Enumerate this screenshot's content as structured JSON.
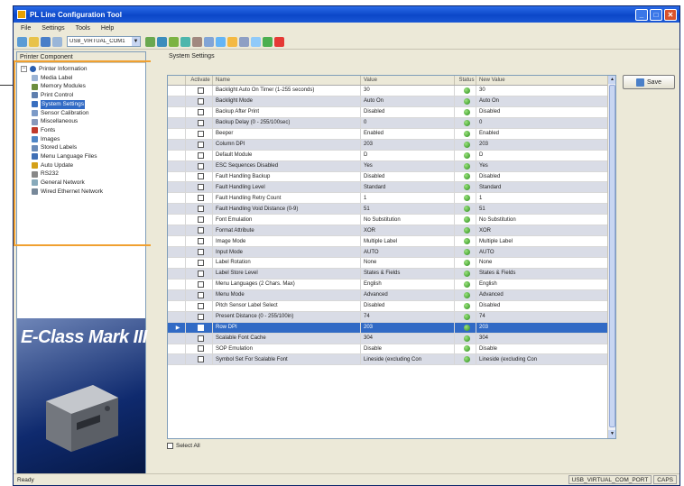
{
  "window": {
    "title": "PL Line Configuration Tool",
    "min": "_",
    "max": "□",
    "close": "✕"
  },
  "menu": [
    "File",
    "Settings",
    "Tools",
    "Help"
  ],
  "toolbar": {
    "port": "USB_VIRTUAL_COM1",
    "port_arrow": "▼"
  },
  "left_panel": {
    "title": "Printer Component",
    "root": "Printer Information",
    "items": [
      {
        "label": "Media Label",
        "icon": "media-label-icon"
      },
      {
        "label": "Memory Modules",
        "icon": "memory-icon"
      },
      {
        "label": "Print Control",
        "icon": "print-control-icon"
      },
      {
        "label": "System Settings",
        "icon": "system-settings-icon",
        "selected": true
      },
      {
        "label": "Sensor Calibration",
        "icon": "sensor-icon"
      },
      {
        "label": "Miscellaneous",
        "icon": "misc-icon"
      },
      {
        "label": "Fonts",
        "icon": "fonts-icon"
      },
      {
        "label": "Images",
        "icon": "images-icon"
      },
      {
        "label": "Stored Labels",
        "icon": "stored-labels-icon"
      },
      {
        "label": "Menu Language Files",
        "icon": "language-icon"
      },
      {
        "label": "Auto Update",
        "icon": "auto-update-icon"
      },
      {
        "label": "RS232",
        "icon": "rs232-icon"
      },
      {
        "label": "General Network",
        "icon": "network-icon"
      },
      {
        "label": "Wired Ethernet Network",
        "icon": "ethernet-icon"
      }
    ],
    "banner": "E-Class Mark III"
  },
  "right_panel": {
    "title": "System Settings",
    "save_label": "Save",
    "select_all": "Select All",
    "columns": {
      "marker": "",
      "activate": "Activate",
      "name": "Name",
      "value": "Value",
      "status": "Status",
      "new_value": "New Value"
    },
    "rows": [
      {
        "name": "Backlight Auto On Timer (1-255 seconds)",
        "value": "30",
        "new_value": "30"
      },
      {
        "name": "Backlight Mode",
        "value": "Auto On",
        "new_value": "Auto On"
      },
      {
        "name": "Backup After Print",
        "value": "Disabled",
        "new_value": "Disabled"
      },
      {
        "name": "Backup Delay (0 - 255/100sec)",
        "value": "0",
        "new_value": "0"
      },
      {
        "name": "Beeper",
        "value": "Enabled",
        "new_value": "Enabled"
      },
      {
        "name": "Column DPI",
        "value": "203",
        "new_value": "203"
      },
      {
        "name": "Default Module",
        "value": "D",
        "new_value": "D"
      },
      {
        "name": "ESC Sequences Disabled",
        "value": "Yes",
        "new_value": "Yes"
      },
      {
        "name": "Fault Handling Backup",
        "value": "Disabled",
        "new_value": "Disabled"
      },
      {
        "name": "Fault Handling Level",
        "value": "Standard",
        "new_value": "Standard"
      },
      {
        "name": "Fault Handling Retry Count",
        "value": "1",
        "new_value": "1"
      },
      {
        "name": "Fault Handling Void Distance (0-9)",
        "value": "51",
        "new_value": "51"
      },
      {
        "name": "Font Emulation",
        "value": "No Substitution",
        "new_value": "No Substitution"
      },
      {
        "name": "Format Attribute",
        "value": "XOR",
        "new_value": "XOR"
      },
      {
        "name": "Image Mode",
        "value": "Multiple Label",
        "new_value": "Multiple Label"
      },
      {
        "name": "Input Mode",
        "value": "AUTO",
        "new_value": "AUTO"
      },
      {
        "name": "Label Rotation",
        "value": "None",
        "new_value": "None"
      },
      {
        "name": "Label Store Level",
        "value": "States & Fields",
        "new_value": "States & Fields"
      },
      {
        "name": "Menu Languages (2 Chars. Max)",
        "value": "English",
        "new_value": "English"
      },
      {
        "name": "Menu Mode",
        "value": "Advanced",
        "new_value": "Advanced"
      },
      {
        "name": "Pitch Sensor Label Select",
        "value": "Disabled",
        "new_value": "Disabled"
      },
      {
        "name": "Present Distance (0 - 255/100in)",
        "value": "74",
        "new_value": "74"
      },
      {
        "name": "Row DPI",
        "value": "203",
        "new_value": "203",
        "selected": true
      },
      {
        "name": "Scalable Font Cache",
        "value": "304",
        "new_value": "304"
      },
      {
        "name": "SOP Emulation",
        "value": "Disable",
        "new_value": "Disable"
      },
      {
        "name": "Symbol Set For Scalable Font",
        "value": "Lineside (excluding Con",
        "new_value": "Lineside (excluding Con"
      }
    ]
  },
  "statusbar": {
    "text": "Ready",
    "port": "USB_VIRTUAL_COM_PORT",
    "cap": "CAPS"
  }
}
